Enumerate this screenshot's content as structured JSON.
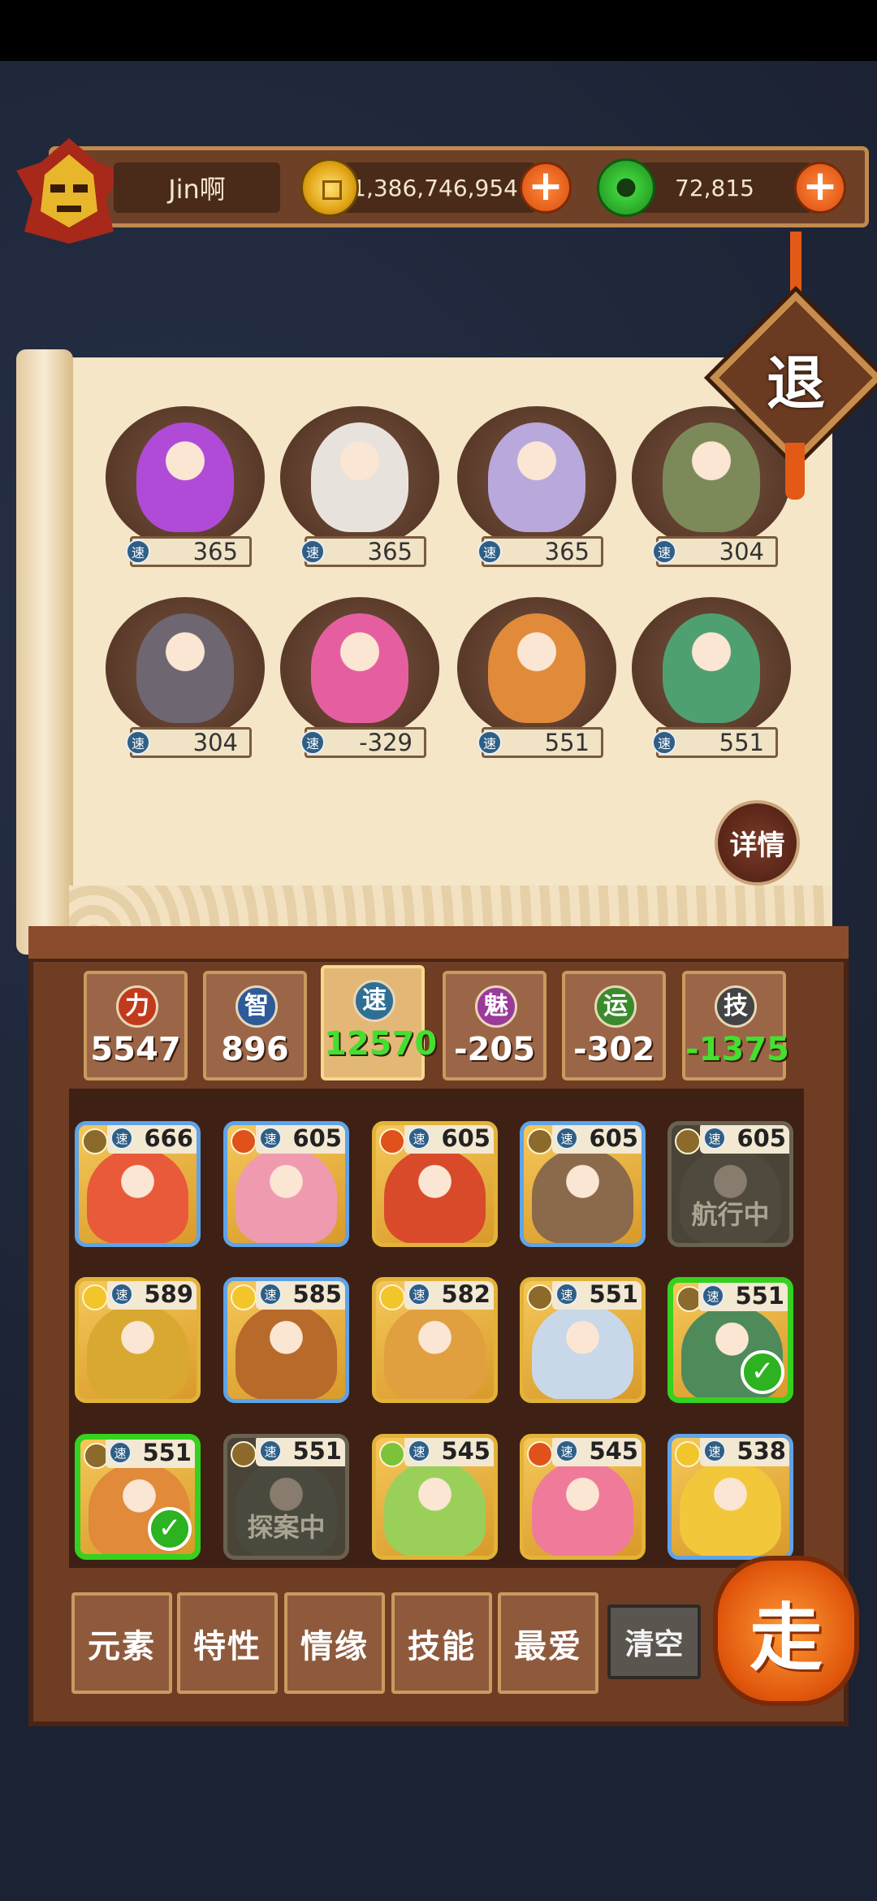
{
  "player": {
    "name": "Jin啊"
  },
  "currency": {
    "coins": "1,386,746,954",
    "gems": "72,815",
    "plus": "+"
  },
  "exit_label": "退",
  "detail_label": "详情",
  "speed_glyph": "速",
  "team": [
    {
      "speed": "365",
      "color": "#b04bd8"
    },
    {
      "speed": "365",
      "color": "#e8e2dc"
    },
    {
      "speed": "365",
      "color": "#b8a8dc"
    },
    {
      "speed": "304",
      "color": "#7c8a5a"
    },
    {
      "speed": "304",
      "color": "#6e6670"
    },
    {
      "speed": "-329",
      "color": "#e55fa0"
    },
    {
      "speed": "551",
      "color": "#e08a3a"
    },
    {
      "speed": "551",
      "color": "#4fa070"
    }
  ],
  "stats": [
    {
      "glyph": "力",
      "value": "5547",
      "icon_color": "#c23a1c",
      "green": false
    },
    {
      "glyph": "智",
      "value": "896",
      "icon_color": "#2e5a9a",
      "green": false
    },
    {
      "glyph": "速",
      "value": "12570",
      "icon_color": "#2f6f96",
      "green": true
    },
    {
      "glyph": "魅",
      "value": "-205",
      "icon_color": "#9a3a9a",
      "green": false
    },
    {
      "glyph": "运",
      "value": "-302",
      "icon_color": "#3a8a2e",
      "green": false
    },
    {
      "glyph": "技",
      "value": "-1375",
      "icon_color": "#444444",
      "green": true
    }
  ],
  "heroes": [
    {
      "speed": "666",
      "element": "earth",
      "border": "blue",
      "art": "#e85a3a",
      "status": "",
      "selected": false
    },
    {
      "speed": "605",
      "element": "fire",
      "border": "blue",
      "art": "#f09ab0",
      "status": "",
      "selected": false
    },
    {
      "speed": "605",
      "element": "fire",
      "border": "gold",
      "art": "#d84a2a",
      "status": "",
      "selected": false
    },
    {
      "speed": "605",
      "element": "earth",
      "border": "blue",
      "art": "#8a6a4a",
      "status": "",
      "selected": false
    },
    {
      "speed": "605",
      "element": "earth",
      "border": "gray",
      "art": "#5a5548",
      "status": "航行中",
      "selected": false
    },
    {
      "speed": "589",
      "element": "sun",
      "border": "gold",
      "art": "#d8a830",
      "status": "",
      "selected": false
    },
    {
      "speed": "585",
      "element": "sun",
      "border": "blue",
      "art": "#b86a2a",
      "status": "",
      "selected": false
    },
    {
      "speed": "582",
      "element": "sun",
      "border": "gold",
      "art": "#e0a040",
      "status": "",
      "selected": false
    },
    {
      "speed": "551",
      "element": "earth",
      "border": "gold",
      "art": "#c8d8e8",
      "status": "",
      "selected": false
    },
    {
      "speed": "551",
      "element": "earth",
      "border": "sel",
      "art": "#4f8a5a",
      "status": "",
      "selected": true
    },
    {
      "speed": "551",
      "element": "earth",
      "border": "sel",
      "art": "#e08a3a",
      "status": "",
      "selected": true
    },
    {
      "speed": "551",
      "element": "earth",
      "border": "gray",
      "art": "#4a5548",
      "status": "探案中",
      "selected": false
    },
    {
      "speed": "545",
      "element": "wood",
      "border": "gold",
      "art": "#9ad05a",
      "status": "",
      "selected": false
    },
    {
      "speed": "545",
      "element": "fire",
      "border": "gold",
      "art": "#f07a9a",
      "status": "",
      "selected": false
    },
    {
      "speed": "538",
      "element": "sun",
      "border": "blue",
      "art": "#f2c83a",
      "status": "",
      "selected": false
    }
  ],
  "filters": [
    "元素",
    "特性",
    "情缘",
    "技能",
    "最爱"
  ],
  "clear_label": "清空",
  "go_label": "走"
}
